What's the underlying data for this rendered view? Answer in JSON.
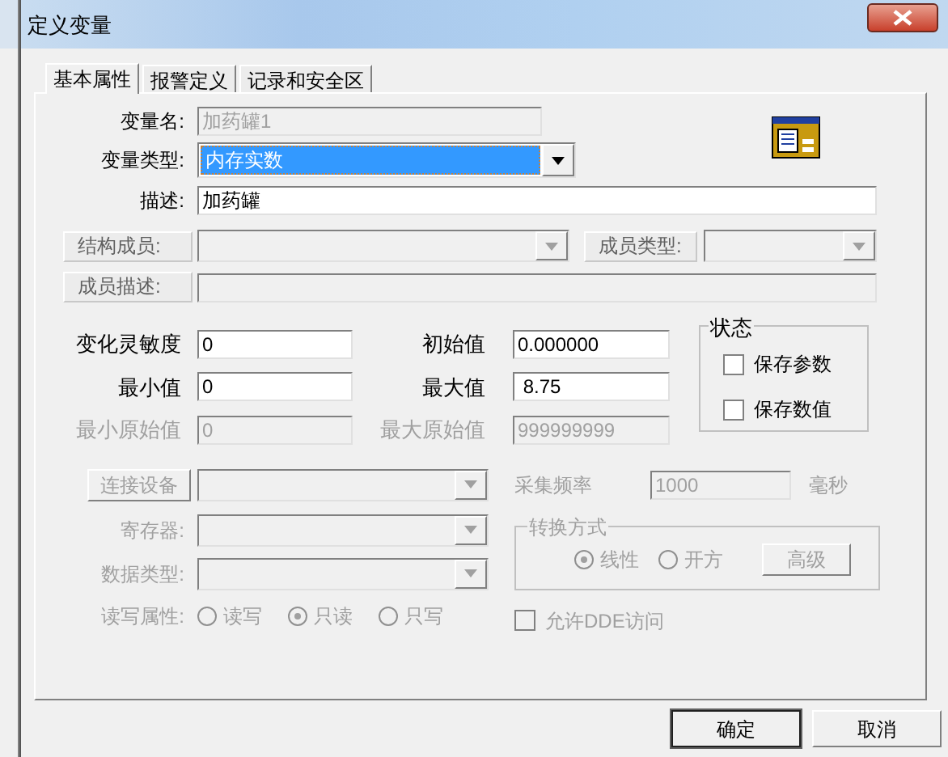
{
  "window": {
    "title": "定义变量"
  },
  "tabs": [
    {
      "label": "基本属性",
      "selected": true
    },
    {
      "label": "报警定义",
      "selected": false
    },
    {
      "label": "记录和安全区",
      "selected": false
    }
  ],
  "variable_name": {
    "label": "变量名:",
    "value": "加药罐1",
    "disabled": true
  },
  "variable_type": {
    "label": "变量类型:",
    "value": "内存实数"
  },
  "description": {
    "label": "描述:",
    "value": "加药罐"
  },
  "struct_member": {
    "label": "结构成员:",
    "disabled": true
  },
  "member_type": {
    "label": "成员类型:",
    "disabled": true
  },
  "member_description": {
    "label": "成员描述:",
    "disabled": true
  },
  "numeric_fields": [
    {
      "label": "变化灵敏度",
      "value": "0",
      "disabled": false
    },
    {
      "label": "初始值",
      "value": "0.000000",
      "disabled": false
    },
    {
      "label": "最小值",
      "value": "0",
      "disabled": false
    },
    {
      "label": "最大值",
      "value": " 8.75",
      "disabled": false
    },
    {
      "label": "最小原始值",
      "value": "0",
      "disabled": true
    },
    {
      "label": "最大原始值",
      "value": "999999999",
      "disabled": true
    }
  ],
  "status_group": {
    "title": "状态",
    "options": [
      {
        "label": "保存参数",
        "checked": false
      },
      {
        "label": "保存数值",
        "checked": false
      }
    ]
  },
  "connect_device": {
    "label": "连接设备",
    "disabled": true
  },
  "sample_rate": {
    "label": "采集频率",
    "value": "1000",
    "unit": "毫秒",
    "disabled": true
  },
  "register": {
    "label": "寄存器:",
    "disabled": true
  },
  "data_type": {
    "label": "数据类型:",
    "disabled": true
  },
  "conversion": {
    "title": "转换方式",
    "disabled": true,
    "options": [
      {
        "label": "线性",
        "selected": true
      },
      {
        "label": "开方",
        "selected": false
      }
    ],
    "advanced_button": "高级"
  },
  "read_write": {
    "label": "读写属性:",
    "disabled": true,
    "options": [
      {
        "label": "读写",
        "selected": false
      },
      {
        "label": "只读",
        "selected": true
      },
      {
        "label": "只写",
        "selected": false
      }
    ]
  },
  "dde_access": {
    "label": "允许DDE访问",
    "checked": false,
    "disabled": true
  },
  "buttons": [
    {
      "label": "确定",
      "default": true
    },
    {
      "label": "取消",
      "default": false
    }
  ]
}
